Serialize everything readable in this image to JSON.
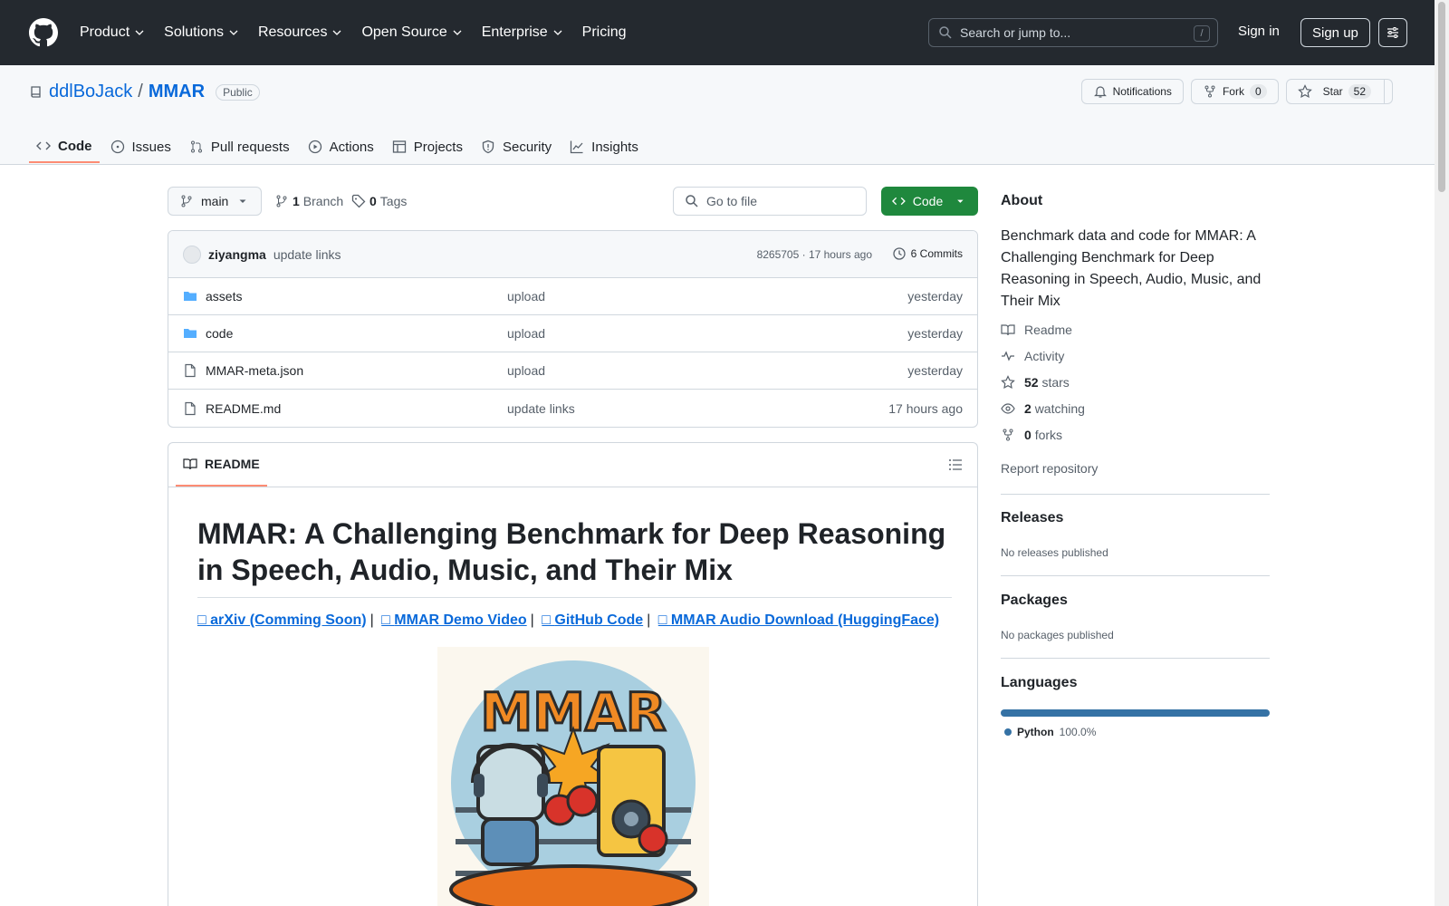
{
  "header": {
    "nav": [
      "Product",
      "Solutions",
      "Resources",
      "Open Source",
      "Enterprise",
      "Pricing"
    ],
    "search_placeholder": "Search or jump to...",
    "search_shortcut": "/",
    "signin": "Sign in",
    "signup": "Sign up"
  },
  "repo": {
    "owner": "ddlBoJack",
    "separator": "/",
    "name": "MMAR",
    "visibility": "Public",
    "notifications": "Notifications",
    "fork_label": "Fork",
    "fork_count": "0",
    "star_label": "Star",
    "star_count": "52"
  },
  "tabs": [
    "Code",
    "Issues",
    "Pull requests",
    "Actions",
    "Projects",
    "Security",
    "Insights"
  ],
  "toolbar": {
    "branch": "main",
    "branch_count": "1",
    "branch_label": "Branch",
    "tag_count": "0",
    "tag_label": "Tags",
    "goto_placeholder": "Go to file",
    "code_button": "Code"
  },
  "commit": {
    "user": "ziyangma",
    "message": "update links",
    "meta": "8265705 · 17 hours ago",
    "commits": "6 Commits"
  },
  "files": [
    {
      "name": "assets",
      "type": "folder",
      "commit": "upload",
      "date": "yesterday"
    },
    {
      "name": "code",
      "type": "folder",
      "commit": "upload",
      "date": "yesterday"
    },
    {
      "name": "MMAR-meta.json",
      "type": "file",
      "commit": "upload",
      "date": "yesterday"
    },
    {
      "name": "README.md",
      "type": "file",
      "commit": "update links",
      "date": "17 hours ago"
    }
  ],
  "readme": {
    "tab": "README",
    "title": "MMAR: A Challenging Benchmark for Deep Reasoning in Speech, Audio, Music, and Their Mix",
    "links": [
      "arXiv (Comming Soon)",
      "MMAR Demo Video",
      "GitHub Code",
      "MMAR Audio Download (HuggingFace)"
    ],
    "link_separator": "|",
    "logo_text": "MMAR"
  },
  "sidebar": {
    "about_heading": "About",
    "description": "Benchmark data and code for MMAR: A Challenging Benchmark for Deep Reasoning in Speech, Audio, Music, and Their Mix",
    "readme": "Readme",
    "activity": "Activity",
    "stars_count": "52",
    "stars_label": "stars",
    "watching_count": "2",
    "watching_label": "watching",
    "forks_count": "0",
    "forks_label": "forks",
    "report": "Report repository",
    "releases_heading": "Releases",
    "releases_note": "No releases published",
    "packages_heading": "Packages",
    "packages_note": "No packages published",
    "languages_heading": "Languages",
    "language_name": "Python",
    "language_pct": "100.0%"
  },
  "colors": {
    "header_bg": "#24292f",
    "accent_blue": "#0969da",
    "code_green": "#1f883d",
    "tab_underline": "#fd8c73",
    "python": "#3572A5",
    "folder": "#54aeff"
  }
}
